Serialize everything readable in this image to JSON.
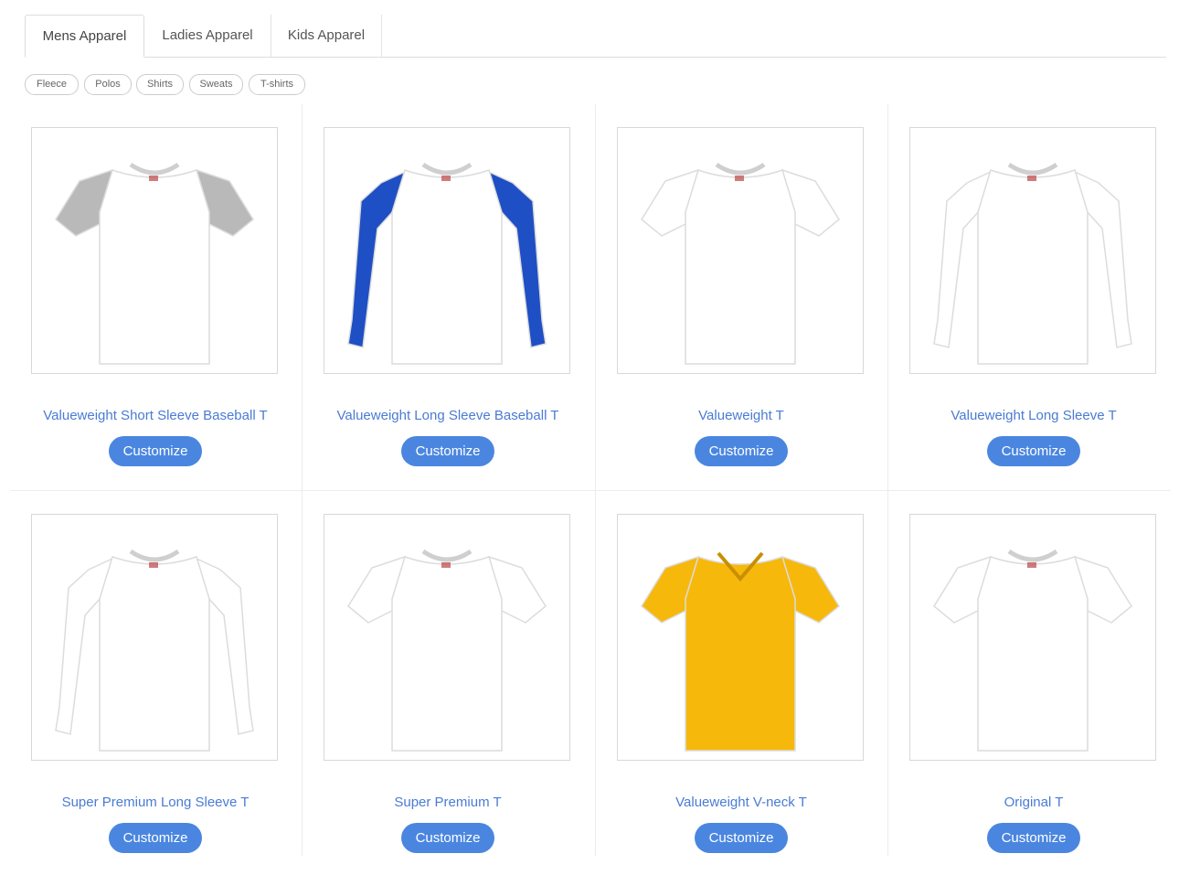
{
  "tabs": [
    {
      "label": "Mens Apparel",
      "active": true
    },
    {
      "label": "Ladies Apparel",
      "active": false
    },
    {
      "label": "Kids Apparel",
      "active": false
    }
  ],
  "filters": [
    "Fleece",
    "Polos",
    "Shirts",
    "Sweats",
    "T-shirts"
  ],
  "products": [
    {
      "title": "Valueweight Short Sleeve Baseball T",
      "button": "Customize",
      "image": "short-sleeve-raglan-tshirt",
      "body_color": "#ffffff",
      "sleeve_color": "#b9b9b9"
    },
    {
      "title": "Valueweight Long Sleeve Baseball T",
      "button": "Customize",
      "image": "long-sleeve-raglan-tshirt",
      "body_color": "#ffffff",
      "sleeve_color": "#1f4fc4"
    },
    {
      "title": "Valueweight T",
      "button": "Customize",
      "image": "short-sleeve-tshirt",
      "body_color": "#ffffff",
      "sleeve_color": "#ffffff"
    },
    {
      "title": "Valueweight Long Sleeve T",
      "button": "Customize",
      "image": "long-sleeve-tshirt",
      "body_color": "#ffffff",
      "sleeve_color": "#ffffff"
    },
    {
      "title": "Super Premium Long Sleeve T",
      "button": "Customize",
      "image": "long-sleeve-tshirt",
      "body_color": "#ffffff",
      "sleeve_color": "#ffffff"
    },
    {
      "title": "Super Premium T",
      "button": "Customize",
      "image": "short-sleeve-tshirt",
      "body_color": "#ffffff",
      "sleeve_color": "#ffffff"
    },
    {
      "title": "Valueweight V-neck T",
      "button": "Customize",
      "image": "vneck-tshirt",
      "body_color": "#f7b80c",
      "sleeve_color": "#f7b80c"
    },
    {
      "title": "Original T",
      "button": "Customize",
      "image": "short-sleeve-tshirt",
      "body_color": "#ffffff",
      "sleeve_color": "#ffffff"
    }
  ],
  "colors": {
    "link": "#4a7bd4",
    "button": "#4a86e0"
  }
}
